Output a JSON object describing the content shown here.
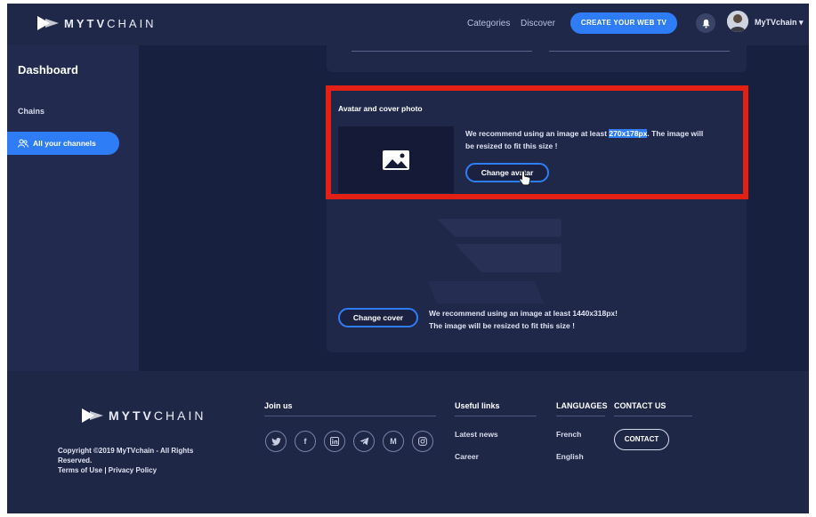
{
  "header": {
    "brand_bold": "MYTV",
    "brand_light": "CHAIN",
    "nav": [
      "Categories",
      "Discover"
    ],
    "cta_label": "CREATE YOUR WEB TV",
    "username": "MyTVchain"
  },
  "sidebar": {
    "title": "Dashboard",
    "section": "Chains",
    "active_item": "All your channels"
  },
  "avatar_section": {
    "title": "Avatar and cover photo",
    "recommend_prefix": "We recommend using an image at least ",
    "recommend_size": "270x178px",
    "recommend_suffix": ". The image will",
    "recommend_line2": "be resized to fit this size !",
    "button": "Change avatar"
  },
  "cover_section": {
    "button": "Change cover",
    "recommend_line1": "We recommend using an image at least 1440x318px!",
    "recommend_line2": "The image will be resized to fit this size !"
  },
  "footer": {
    "brand_bold": "MYTV",
    "brand_light": "CHAIN",
    "copyright": "Copyright ©2019 MyTVchain - All Rights Reserved.",
    "legal": "Terms of Use | Privacy Policy",
    "join_us": "Join us",
    "useful_links": "Useful links",
    "links": [
      "Latest news",
      "Career"
    ],
    "languages": "LANGUAGES",
    "language_items": [
      "French",
      "English"
    ],
    "contact_us": "CONTACT US",
    "contact_button": "CONTACT"
  },
  "colors": {
    "accent": "#2f7df6",
    "highlight_box": "#e41f14",
    "background": "#1b2241"
  }
}
